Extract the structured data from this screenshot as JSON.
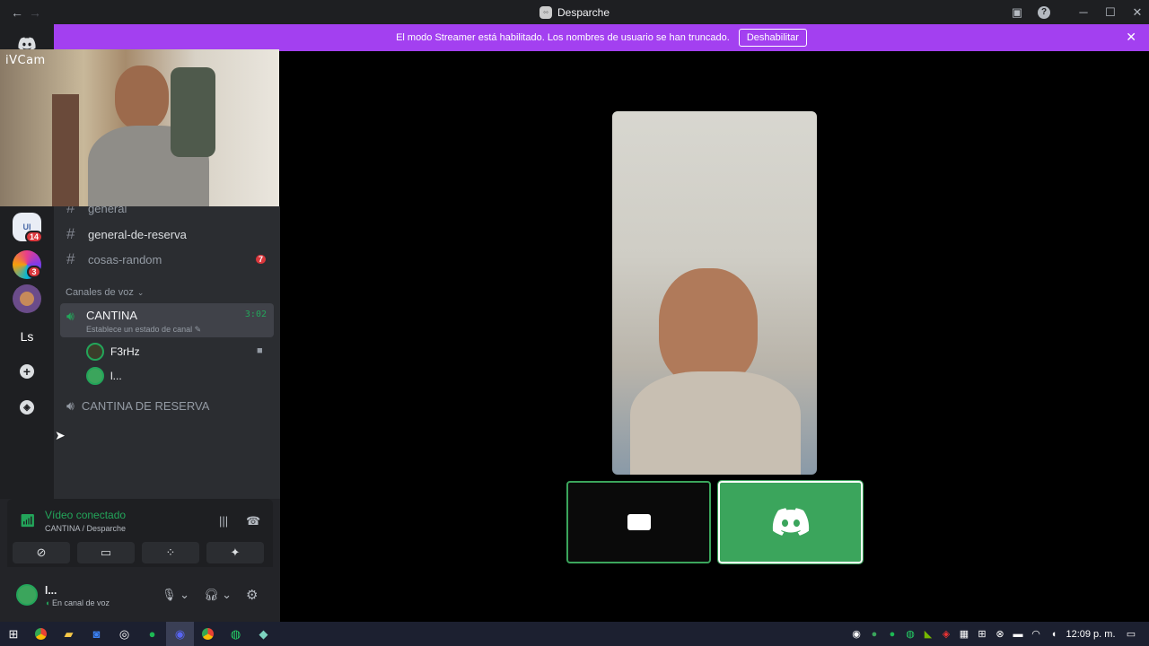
{
  "window": {
    "title": "Desparche"
  },
  "banner": {
    "message": "El modo Streamer está habilitado. Los nombres de usuario se han truncado.",
    "disable_label": "Deshabilitar"
  },
  "ivcam": {
    "label": "iVCam"
  },
  "servers": [
    {
      "name": "server-1",
      "badge": "14"
    },
    {
      "name": "server-2",
      "badge": "3"
    },
    {
      "name": "server-3",
      "badge": ""
    },
    {
      "name": "server-ls",
      "label": "Ls"
    }
  ],
  "channels": {
    "text": [
      {
        "name": "general"
      },
      {
        "name": "general-de-reserva"
      },
      {
        "name": "cosas-random",
        "badge": "7"
      }
    ],
    "voice_category": "Canales de voz",
    "voice": [
      {
        "name": "CANTINA",
        "timer": "3:02",
        "status": "Establece un estado de canal",
        "members": [
          "F3rHz",
          "l..."
        ]
      },
      {
        "name": "CANTINA DE RESERVA"
      }
    ]
  },
  "voice_status": {
    "title": "Vídeo conectado",
    "subtitle": "CANTINA / Desparche"
  },
  "user": {
    "name": "l...",
    "status": "En canal de voz"
  },
  "taskbar": {
    "time": "12:09 p. m."
  },
  "colors": {
    "accent": "#a340f0",
    "connected": "#23a55a",
    "tile_green": "#3ba55c"
  }
}
